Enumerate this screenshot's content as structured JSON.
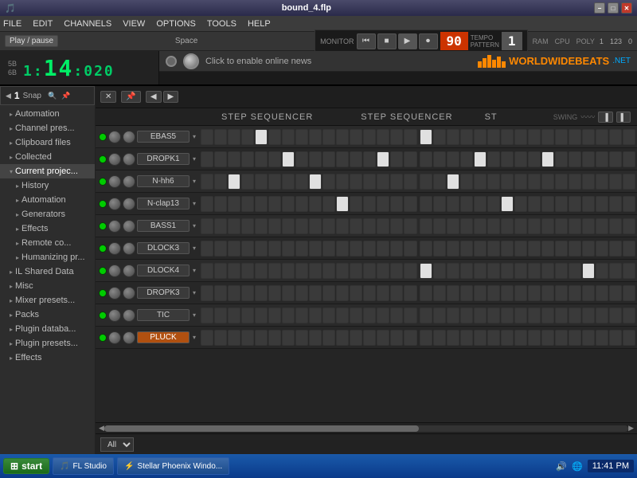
{
  "titleBar": {
    "title": "bound_4.flp",
    "buttons": [
      "−",
      "□",
      "✕"
    ]
  },
  "menuBar": {
    "items": [
      "FILE",
      "EDIT",
      "CHANNELS",
      "VIEW",
      "OPTIONS",
      "TOOLS",
      "HELP"
    ]
  },
  "toolbar": {
    "playPause": "Play / pause",
    "shortcut": "Space"
  },
  "topStats": {
    "ram": "RAM",
    "cpu": "CPU",
    "poly": "POLY",
    "ramVal": "1",
    "cpuVal": "123",
    "polyVal": "0"
  },
  "transport": {
    "bpm": "90",
    "pattern": "1",
    "tempo_label": "TEMPO",
    "pattern_label": "PATTERN"
  },
  "timeDisplay": {
    "time": "1:14:020"
  },
  "newsBar": {
    "text": "Click to enable online news",
    "logo": "WORLDWIDEBEATS",
    "net": ".NET"
  },
  "snap": {
    "label": "1 Snap",
    "value": "1"
  },
  "seqHeader": {
    "col1": "STEP SEQUENCER",
    "col2": "STEP SEQUENCER",
    "col3": "ST",
    "swing": "SWING"
  },
  "sidebar": {
    "items": [
      {
        "label": "Automation",
        "indent": 1,
        "icon": "▸"
      },
      {
        "label": "Channel pres...",
        "indent": 1,
        "icon": "▸"
      },
      {
        "label": "Clipboard files",
        "indent": 1,
        "icon": "▸"
      },
      {
        "label": "Collected",
        "indent": 1,
        "icon": "▸"
      },
      {
        "label": "Current projec...",
        "indent": 1,
        "icon": "▾"
      },
      {
        "label": "History",
        "indent": 2,
        "icon": "▸"
      },
      {
        "label": "Automation",
        "indent": 2,
        "icon": "▸"
      },
      {
        "label": "Generators",
        "indent": 2,
        "icon": "▸"
      },
      {
        "label": "Effects",
        "indent": 2,
        "icon": "▸"
      },
      {
        "label": "Remote co...",
        "indent": 2,
        "icon": "▸"
      },
      {
        "label": "Humanizing pr...",
        "indent": 2,
        "icon": "▸"
      },
      {
        "label": "IL Shared Data",
        "indent": 1,
        "icon": "▸"
      },
      {
        "label": "Misc",
        "indent": 1,
        "icon": "▸"
      },
      {
        "label": "Mixer presets...",
        "indent": 1,
        "icon": "▸"
      },
      {
        "label": "Packs",
        "indent": 1,
        "icon": "▸"
      },
      {
        "label": "Plugin databa...",
        "indent": 1,
        "icon": "▸"
      },
      {
        "label": "Plugin presets...",
        "indent": 1,
        "icon": "▸"
      },
      {
        "label": "Effects",
        "indent": 1,
        "icon": "▸"
      }
    ]
  },
  "sequencer": {
    "rows": [
      {
        "name": "EBAS5",
        "highlighted": false,
        "pattern": [
          0,
          0,
          0,
          0,
          1,
          0,
          0,
          0,
          0,
          0,
          0,
          0,
          0,
          0,
          0,
          0,
          1,
          0,
          0,
          0,
          0,
          0,
          0,
          0,
          0,
          0,
          0,
          0,
          0,
          0,
          0,
          0
        ]
      },
      {
        "name": "DROPK1",
        "highlighted": false,
        "pattern": [
          0,
          0,
          0,
          0,
          0,
          0,
          1,
          0,
          0,
          0,
          0,
          0,
          0,
          1,
          0,
          0,
          0,
          0,
          0,
          0,
          1,
          0,
          0,
          0,
          0,
          1,
          0,
          0,
          0,
          0,
          0,
          0
        ]
      },
      {
        "name": "N-hh6",
        "highlighted": false,
        "pattern": [
          0,
          0,
          1,
          0,
          0,
          0,
          0,
          0,
          1,
          0,
          0,
          0,
          0,
          0,
          0,
          0,
          0,
          0,
          1,
          0,
          0,
          0,
          0,
          0,
          0,
          0,
          0,
          0,
          0,
          0,
          0,
          0
        ]
      },
      {
        "name": "N-clap13",
        "highlighted": false,
        "pattern": [
          0,
          0,
          0,
          0,
          0,
          0,
          0,
          0,
          0,
          0,
          1,
          0,
          0,
          0,
          0,
          0,
          0,
          0,
          0,
          0,
          0,
          0,
          1,
          0,
          0,
          0,
          0,
          0,
          0,
          0,
          0,
          0
        ]
      },
      {
        "name": "BASS1",
        "highlighted": false,
        "pattern": [
          0,
          0,
          0,
          0,
          0,
          0,
          0,
          0,
          0,
          0,
          0,
          0,
          0,
          0,
          0,
          0,
          0,
          0,
          0,
          0,
          0,
          0,
          0,
          0,
          0,
          0,
          0,
          0,
          0,
          0,
          0,
          0
        ]
      },
      {
        "name": "DLOCK3",
        "highlighted": false,
        "pattern": [
          0,
          0,
          0,
          0,
          0,
          0,
          0,
          0,
          0,
          0,
          0,
          0,
          0,
          0,
          0,
          0,
          0,
          0,
          0,
          0,
          0,
          0,
          0,
          0,
          0,
          0,
          0,
          0,
          0,
          0,
          0,
          0
        ]
      },
      {
        "name": "DLOCK4",
        "highlighted": false,
        "pattern": [
          0,
          0,
          0,
          0,
          0,
          0,
          0,
          0,
          0,
          0,
          0,
          0,
          0,
          0,
          0,
          0,
          1,
          0,
          0,
          0,
          0,
          0,
          0,
          0,
          0,
          0,
          0,
          0,
          1,
          0,
          0,
          0
        ]
      },
      {
        "name": "DROPK3",
        "highlighted": false,
        "pattern": [
          0,
          0,
          0,
          0,
          0,
          0,
          0,
          0,
          0,
          0,
          0,
          0,
          0,
          0,
          0,
          0,
          0,
          0,
          0,
          0,
          0,
          0,
          0,
          0,
          0,
          0,
          0,
          0,
          0,
          0,
          0,
          0
        ]
      },
      {
        "name": "TIC",
        "highlighted": false,
        "pattern": [
          0,
          0,
          0,
          0,
          0,
          0,
          0,
          0,
          0,
          0,
          0,
          0,
          0,
          0,
          0,
          0,
          0,
          0,
          0,
          0,
          0,
          0,
          0,
          0,
          0,
          0,
          0,
          0,
          0,
          0,
          0,
          0
        ]
      },
      {
        "name": "PLUCK",
        "highlighted": true,
        "pattern": [
          0,
          0,
          0,
          0,
          0,
          0,
          0,
          0,
          0,
          0,
          0,
          0,
          0,
          0,
          0,
          0,
          0,
          0,
          0,
          0,
          0,
          0,
          0,
          0,
          0,
          0,
          0,
          0,
          0,
          0,
          0,
          0
        ]
      }
    ]
  },
  "bottomBar": {
    "channelLabel": "All"
  },
  "taskbar": {
    "start": "start",
    "items": [
      {
        "label": "FL Studio",
        "icon": "🎵"
      },
      {
        "label": "Stellar Phoenix Windo...",
        "icon": "⚡"
      }
    ],
    "time": "11:41 PM",
    "trayIcons": [
      "🔊",
      "🌐"
    ]
  }
}
